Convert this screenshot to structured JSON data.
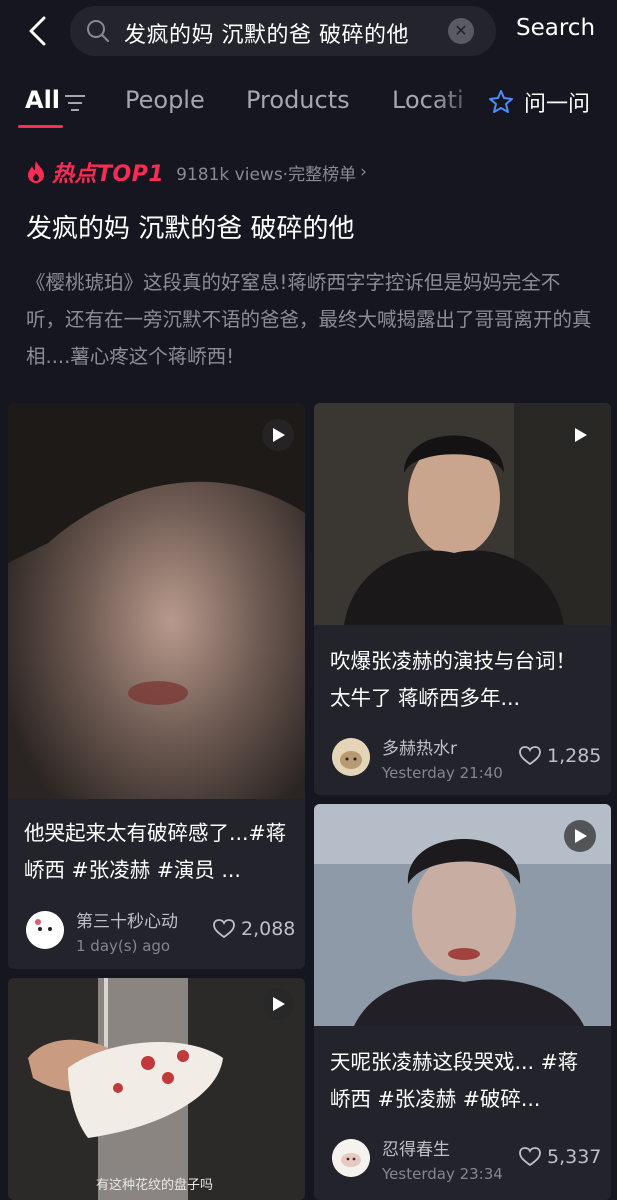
{
  "search": {
    "query": "发疯的妈 沉默的爸 破碎的他",
    "button_label": "Search"
  },
  "tabs": [
    {
      "label": "All"
    },
    {
      "label": "People"
    },
    {
      "label": "Products"
    },
    {
      "label": "Locati"
    }
  ],
  "ask": {
    "label": "问一问"
  },
  "hot": {
    "badge": "热点TOP1",
    "meta": "9181k views·完整榜单",
    "headline": "发疯的妈 沉默的爸 破碎的他",
    "description": "《樱桃琥珀》这段真的好窒息!蒋峤西字字控诉但是妈妈完全不听，还有在一旁沉默不语的爸爸，最终大喊揭露出了哥哥离开的真相....薯心疼这个蒋峤西!"
  },
  "cards": [
    {
      "title": "他哭起来太有破碎感了...#蒋峤西 #张凌赫 #演员 ...",
      "author": "第三十秒心动",
      "time": "1 day(s) ago",
      "likes": "2,088"
    },
    {
      "title": "吹爆张凌赫的演技与台词！太牛了 蒋峤西多年...",
      "author": "多赫热水r",
      "time": "Yesterday 21:40",
      "likes": "1,285"
    },
    {
      "title": "天呢张凌赫这段哭戏... #蒋峤西 #张凌赫 #破碎...",
      "author": "忍得春生",
      "time": "Yesterday 23:34",
      "likes": "5,337"
    },
    {
      "caption": "有这种花纹的盘子吗"
    }
  ],
  "colors": {
    "background": "#161620",
    "accent": "#fe2c55",
    "card": "#23232b"
  }
}
